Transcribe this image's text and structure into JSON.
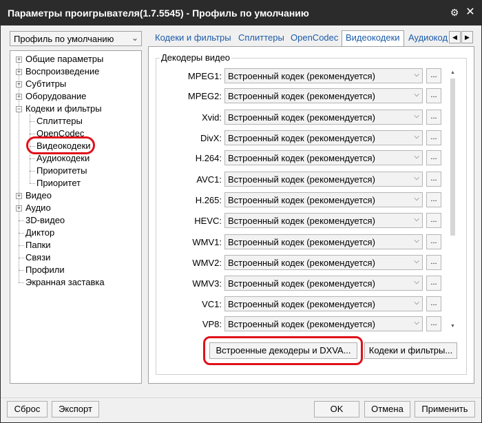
{
  "window": {
    "title": "Параметры проигрывателя(1.7.5545) - Профиль по умолчанию",
    "pin_icon": "pin-icon",
    "close_icon": "close-icon"
  },
  "profile": {
    "selected": "Профиль по умолчанию"
  },
  "tree": {
    "items": [
      {
        "label": "Общие параметры"
      },
      {
        "label": "Воспроизведение"
      },
      {
        "label": "Субтитры"
      },
      {
        "label": "Оборудование"
      },
      {
        "label": "Кодеки и фильтры"
      },
      {
        "label": "Сплиттеры"
      },
      {
        "label": "OpenCodec"
      },
      {
        "label": "Видеокодеки"
      },
      {
        "label": "Аудиокодеки"
      },
      {
        "label": "Приоритеты"
      },
      {
        "label": "Приоритет"
      },
      {
        "label": "Видео"
      },
      {
        "label": "Аудио"
      },
      {
        "label": "3D-видео"
      },
      {
        "label": "Диктор"
      },
      {
        "label": "Папки"
      },
      {
        "label": "Связи"
      },
      {
        "label": "Профили"
      },
      {
        "label": "Экранная заставка"
      }
    ]
  },
  "tabs": [
    {
      "label": "Кодеки и фильтры"
    },
    {
      "label": "Сплиттеры"
    },
    {
      "label": "OpenCodec"
    },
    {
      "label": "Видеокодеки",
      "active": true
    },
    {
      "label": "Аудиокод"
    }
  ],
  "group": {
    "title": "Декодеры видео",
    "rows": [
      {
        "label": "MPEG1:",
        "value": "Встроенный кодек (рекомендуется)"
      },
      {
        "label": "MPEG2:",
        "value": "Встроенный кодек (рекомендуется)"
      },
      {
        "label": "Xvid:",
        "value": "Встроенный кодек (рекомендуется)"
      },
      {
        "label": "DivX:",
        "value": "Встроенный кодек (рекомендуется)"
      },
      {
        "label": "H.264:",
        "value": "Встроенный кодек (рекомендуется)"
      },
      {
        "label": "AVC1:",
        "value": "Встроенный кодек (рекомендуется)"
      },
      {
        "label": "H.265:",
        "value": "Встроенный кодек (рекомендуется)"
      },
      {
        "label": "HEVC:",
        "value": "Встроенный кодек (рекомендуется)"
      },
      {
        "label": "WMV1:",
        "value": "Встроенный кодек (рекомендуется)"
      },
      {
        "label": "WMV2:",
        "value": "Встроенный кодек (рекомендуется)"
      },
      {
        "label": "WMV3:",
        "value": "Встроенный кодек (рекомендуется)"
      },
      {
        "label": "VC1:",
        "value": "Встроенный кодек (рекомендуется)"
      },
      {
        "label": "VP8:",
        "value": "Встроенный кодек (рекомендуется)"
      }
    ],
    "more_label": "..."
  },
  "panel_buttons": {
    "builtin_decoders": "Встроенные декодеры и DXVA...",
    "codecs_filters": "Кодеки и фильтры..."
  },
  "footer": {
    "reset": "Сброс",
    "export": "Экспорт",
    "ok": "OK",
    "cancel": "Отмена",
    "apply": "Применить"
  },
  "colors": {
    "titlebar": "#2b2b2b",
    "highlight": "#e0101a",
    "tab_text": "#1a5aa8"
  }
}
